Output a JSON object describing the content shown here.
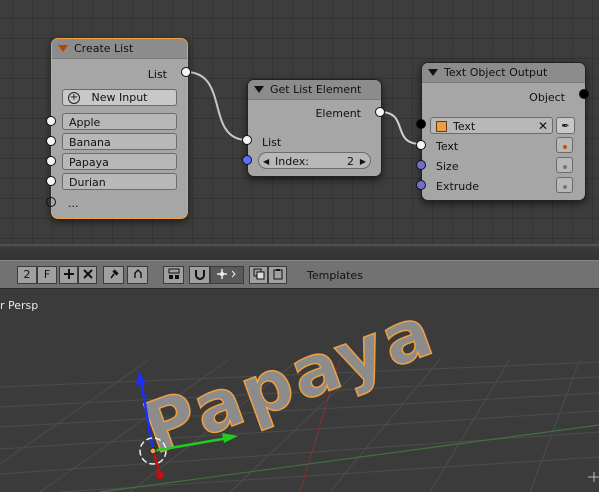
{
  "node_editor": {
    "create_list": {
      "title": "Create List",
      "output_label": "List",
      "new_input_label": "New Input",
      "items": [
        "Apple",
        "Banana",
        "Papaya",
        "Durian"
      ],
      "more_label": "..."
    },
    "get_list_element": {
      "title": "Get List Element",
      "output_label": "Element",
      "input_label": "List",
      "index_label": "Index:",
      "index_value": "2"
    },
    "text_object_output": {
      "title": "Text Object Output",
      "output_label": "Object",
      "object_value": "Text",
      "inputs": [
        "Text",
        "Size",
        "Extrude"
      ]
    },
    "colors": {
      "socket_blue": "#5a6eff",
      "socket_violet": "#7070c8",
      "selected_outline": "#f0a040",
      "link": "#c8c8c8"
    }
  },
  "toolbar": {
    "users_count": "2",
    "fake_user": "F",
    "templates_label": "Templates"
  },
  "viewport": {
    "view_label": "r Persp",
    "text_object": "Papaya",
    "text_color": "#8c8c8c",
    "outline_color": "#f0a040"
  }
}
